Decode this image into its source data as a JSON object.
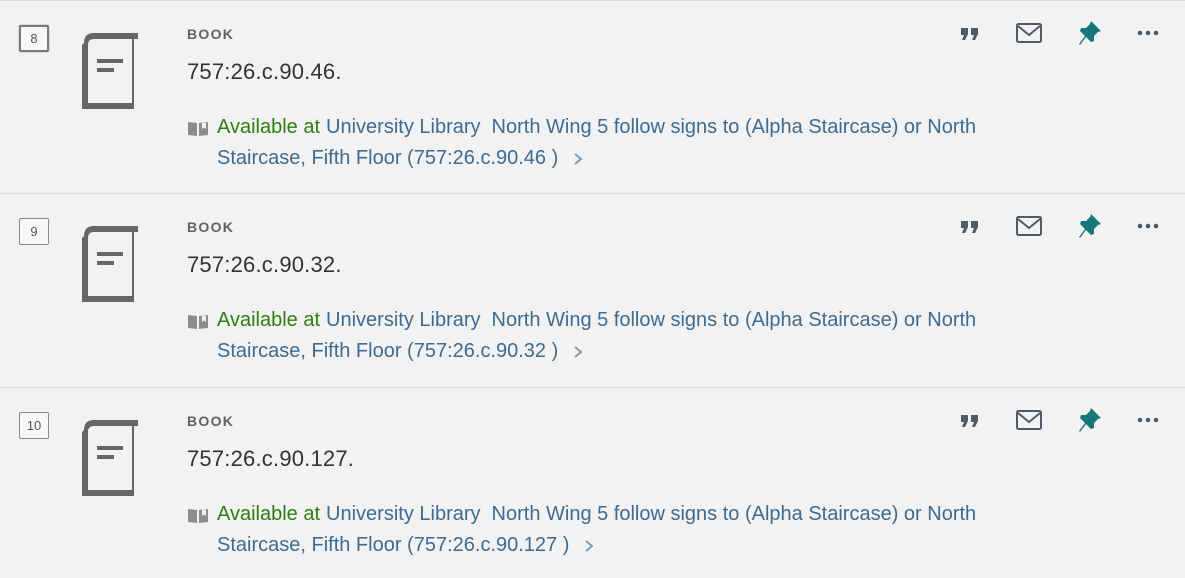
{
  "results": [
    {
      "number": "8",
      "type": "BOOK",
      "title": "757:26.c.90.46.",
      "status": "Available at",
      "library": "University Library",
      "location_line1": "North Wing 5 follow signs to (Alpha Staircase) or North",
      "location_line2": "Staircase, Fifth Floor (757:26.c.90.46 )"
    },
    {
      "number": "9",
      "type": "BOOK",
      "title": "757:26.c.90.32.",
      "status": "Available at",
      "library": "University Library",
      "location_line1": "North Wing 5 follow signs to (Alpha Staircase) or North",
      "location_line2": "Staircase, Fifth Floor (757:26.c.90.32 )"
    },
    {
      "number": "10",
      "type": "BOOK",
      "title": "757:26.c.90.127.",
      "status": "Available at",
      "library": "University Library",
      "location_line1": "North Wing 5 follow signs to (Alpha Staircase) or North",
      "location_line2": "Staircase, Fifth Floor (757:26.c.90.127 )"
    }
  ],
  "icons": {
    "thumbnail": "book-icon",
    "availability": "open-book-icon",
    "cite": "quote-icon",
    "email": "envelope-icon",
    "pin": "pushpin-icon",
    "more": "ellipsis-icon",
    "expand": "chevron-right-icon"
  },
  "colors": {
    "available": "#2e7d13",
    "link": "#3d6b91",
    "pin": "#17777a",
    "icon": "#4e5a66"
  }
}
